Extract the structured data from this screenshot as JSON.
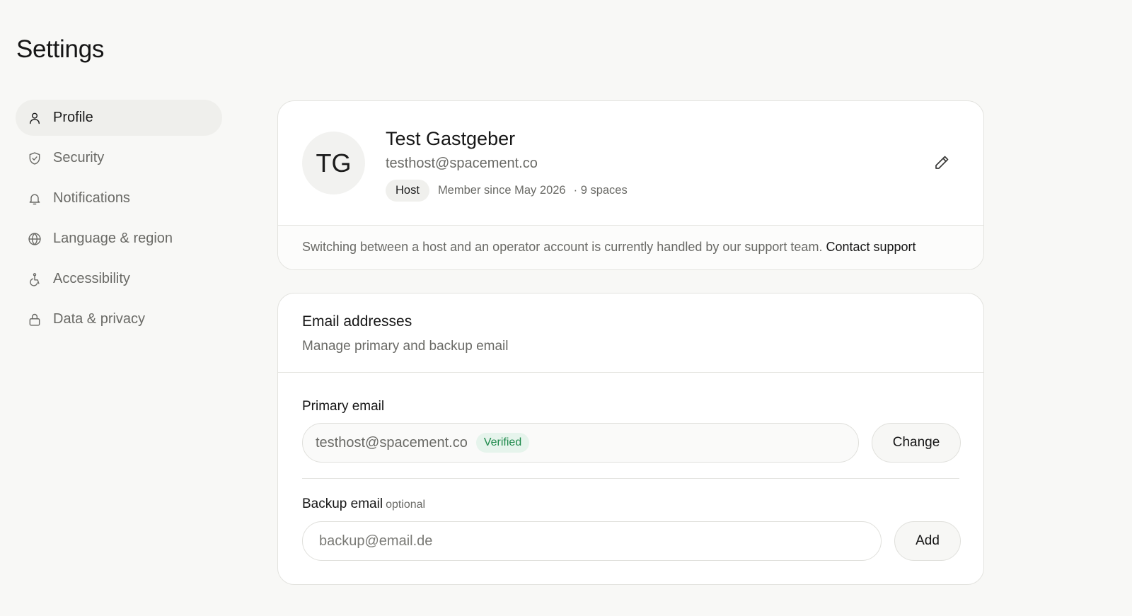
{
  "page": {
    "title": "Settings"
  },
  "sidebar": {
    "items": [
      {
        "label": "Profile",
        "icon": "user-icon",
        "active": true
      },
      {
        "label": "Security",
        "icon": "shield-icon",
        "active": false
      },
      {
        "label": "Notifications",
        "icon": "bell-icon",
        "active": false
      },
      {
        "label": "Language & region",
        "icon": "globe-icon",
        "active": false
      },
      {
        "label": "Accessibility",
        "icon": "accessibility-icon",
        "active": false
      },
      {
        "label": "Data & privacy",
        "icon": "lock-icon",
        "active": false
      }
    ]
  },
  "profile": {
    "initials": "TG",
    "name": "Test Gastgeber",
    "email": "testhost@spacement.co",
    "role": "Host",
    "member_since": "Member since May 2026",
    "spaces": "· 9 spaces",
    "note": "Switching between a host and an operator account is currently handled by our support team.",
    "contact_link": "Contact support"
  },
  "email_section": {
    "title": "Email addresses",
    "subtitle": "Manage primary and backup email",
    "primary": {
      "label": "Primary email",
      "value": "testhost@spacement.co",
      "status": "Verified",
      "button": "Change"
    },
    "backup": {
      "label": "Backup email",
      "optional": "optional",
      "placeholder": "backup@email.de",
      "button": "Add"
    }
  },
  "colors": {
    "background": "#f8f8f6",
    "card": "#ffffff",
    "border": "#e3e3df",
    "verified_text": "#1f8a4c",
    "verified_bg": "#e6f4ec"
  }
}
